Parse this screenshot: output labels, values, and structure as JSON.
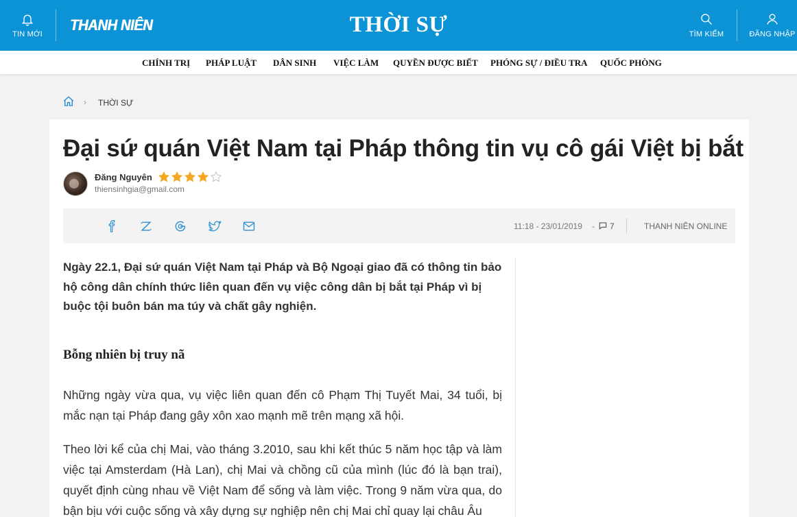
{
  "header": {
    "new_label": "TIN MỚI",
    "logo": "THANH NIÊN",
    "section": "THỜI SỰ",
    "search_label": "TÌM KIẾM",
    "login_label": "ĐĂNG NHẬP",
    "bg_color": "#0b93d6"
  },
  "subnav": {
    "items": [
      "CHÍNH TRỊ",
      "PHÁP LUẬT",
      "DÂN SINH",
      "VIỆC LÀM",
      "QUYỀN ĐƯỢC BIẾT",
      "PHÓNG SỰ / ĐIỀU TRA",
      "QUỐC PHÒNG"
    ]
  },
  "breadcrumb": {
    "home_icon": "home-icon",
    "category": "THỜI SỰ"
  },
  "article": {
    "title": "Đại sứ quán Việt Nam tại Pháp thông tin vụ cô gái Việt bị bắt",
    "author": {
      "name": "Đăng Nguyên",
      "email": "thiensinhgia@gmail.com",
      "rating": 4,
      "rating_max": 5,
      "star_color": "#f5a623"
    },
    "share": {
      "icons": [
        "facebook-icon",
        "zalo-icon",
        "google-plus-icon",
        "twitter-icon",
        "mail-icon"
      ]
    },
    "meta": {
      "time": "11:18 - 23/01/2019",
      "dash": "-",
      "comments": "7",
      "source": "THANH NIÊN ONLINE"
    },
    "sapo": "Ngày 22.1, Đại sứ quán Việt Nam tại Pháp và Bộ Ngoại giao đã có thông tin bảo hộ công dân chính thức liên quan đến vụ việc công dân bị bắt tại Pháp vì bị buộc tội buôn bán ma túy và chất gây nghiện.",
    "subheading": "Bỗng nhiên bị truy nã",
    "paragraphs": [
      "Những ngày vừa qua, vụ việc liên quan đến cô Phạm Thị Tuyết Mai, 34 tuổi, bị mắc nạn tại Pháp đang gây xôn xao mạnh mẽ trên mạng xã hội.",
      "Theo lời kể của chị Mai, vào tháng 3.2010, sau khi kết thúc 5 năm học tập và làm việc tại Amsterdam (Hà Lan), chị Mai và chồng cũ của mình (lúc đó là bạn trai), quyết định cùng nhau về Việt Nam để sống và làm việc. Trong 9 năm vừa qua, do bận bịu với cuộc sống và xây dựng sự nghiệp nên chị Mai chỉ quay lại châu Âu"
    ]
  }
}
